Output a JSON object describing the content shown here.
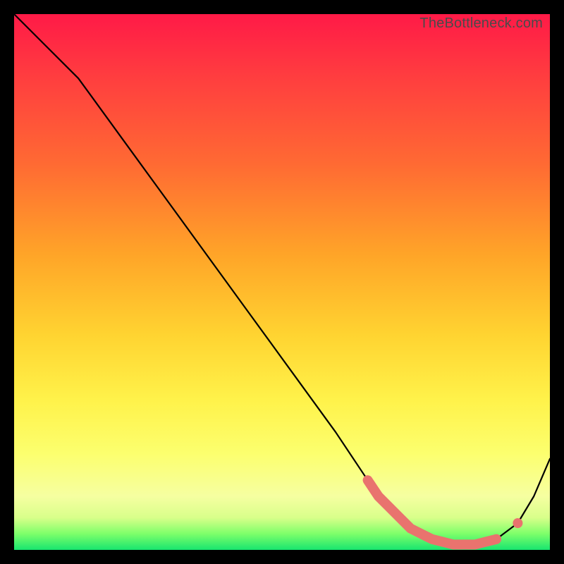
{
  "watermark": "TheBottleneck.com",
  "chart_data": {
    "type": "line",
    "title": "",
    "xlabel": "",
    "ylabel": "",
    "xlim": [
      0,
      100
    ],
    "ylim": [
      0,
      100
    ],
    "grid": false,
    "legend": false,
    "series": [
      {
        "name": "bottleneck-curve",
        "x": [
          0,
          6,
          12,
          20,
          28,
          36,
          44,
          52,
          60,
          66,
          70,
          74,
          78,
          82,
          86,
          90,
          94,
          97,
          100
        ],
        "y": [
          100,
          94,
          88,
          77,
          66,
          55,
          44,
          33,
          22,
          13,
          8,
          4,
          2,
          1,
          1,
          2,
          5,
          10,
          17
        ]
      }
    ],
    "highlight": {
      "name": "sweet-spot-dots",
      "x": [
        66,
        68,
        70,
        72,
        74,
        76,
        78,
        80,
        82,
        84,
        86,
        88,
        90,
        94
      ],
      "y": [
        13,
        10,
        8,
        6,
        4,
        3,
        2,
        1.5,
        1,
        1,
        1,
        1.5,
        2,
        5
      ]
    },
    "colors": {
      "line": "#000000",
      "dots": "#e9736e",
      "gradient_top": "#ff1a47",
      "gradient_mid": "#ffd431",
      "gradient_bottom": "#18e56f"
    }
  }
}
